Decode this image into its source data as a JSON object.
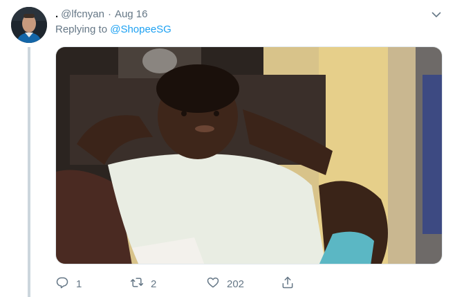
{
  "tweet": {
    "display_name": ".",
    "handle": "@lfcnyan",
    "separator": "·",
    "date": "Aug 16",
    "replying_prefix": "Replying to",
    "replying_to": "@ShopeeSG",
    "media": {
      "description_icon": "gif-image"
    },
    "actions": {
      "reply_count": "1",
      "retweet_count": "2",
      "like_count": "202"
    }
  },
  "colors": {
    "accent": "#1da1f2",
    "secondary_text": "#657786",
    "thread_line": "#ccd6dd"
  },
  "icons": {
    "menu": "chevron-down-icon",
    "reply": "reply-icon",
    "retweet": "retweet-icon",
    "like": "heart-icon",
    "share": "share-icon"
  }
}
